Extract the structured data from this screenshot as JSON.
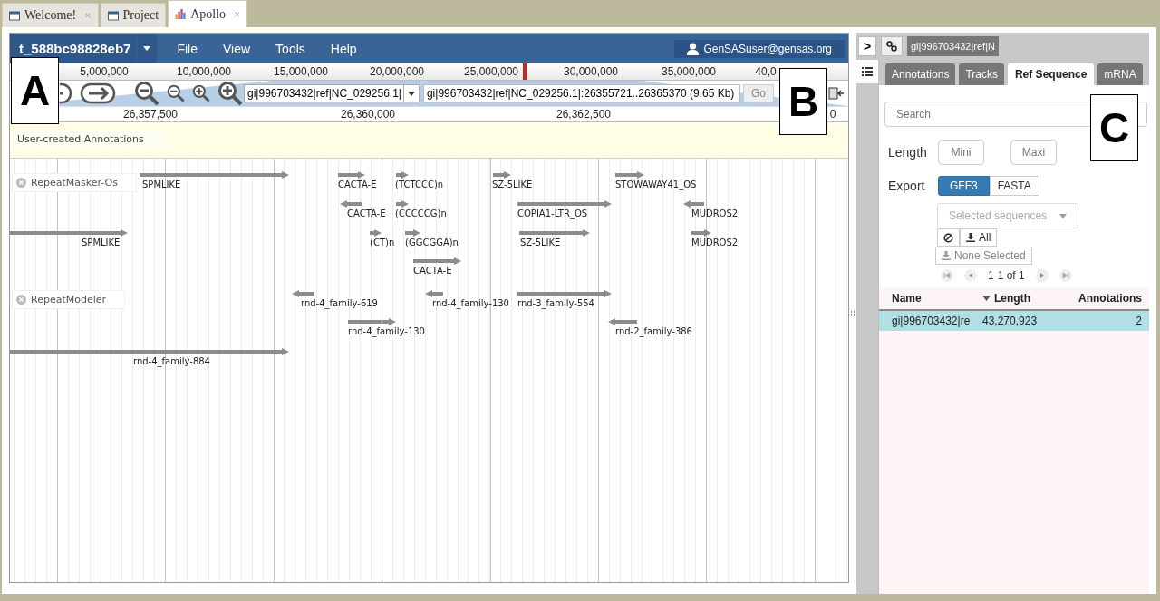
{
  "tabs": [
    {
      "label": "Welcome!",
      "close": "×",
      "selected": false
    },
    {
      "label": "Project",
      "selected": false
    },
    {
      "label": "Apollo",
      "close": "×",
      "selected": true
    }
  ],
  "browser": {
    "track_menu": "t_588bc98828eb7",
    "menu": [
      "File",
      "View",
      "Tools",
      "Help"
    ],
    "user": "GenSASuser@gensas.org",
    "overview_ticks": [
      "5,000,000",
      "10,000,000",
      "15,000,000",
      "20,000,000",
      "25,000,000",
      "30,000,000",
      "35,000,000",
      "40,0"
    ],
    "sequence_select": "gi|996703432|ref|NC_029256.1|",
    "location": "gi|996703432|ref|NC_029256.1|:26355721..26365370 (9.65 Kb)",
    "go": "Go",
    "detail_ticks": [
      "26,357,500",
      "26,360,000",
      "26,362,500",
      "0"
    ],
    "user_track": "User-created Annotations",
    "tracks": [
      {
        "name": "RepeatMasker-Os",
        "features": [
          {
            "label": "SPMLIKE",
            "reverse": false
          },
          {
            "label": "CACTA-E",
            "reverse": false
          },
          {
            "label": "(TCTCCC)n",
            "reverse": false
          },
          {
            "label": "SZ-5LIKE",
            "reverse": false
          },
          {
            "label": "STOWAWAY41_OS",
            "reverse": false
          },
          {
            "label": "CACTA-E",
            "reverse": true
          },
          {
            "label": "(CCCCCG)n",
            "reverse": false
          },
          {
            "label": "COPIA1-LTR_OS",
            "reverse": false
          },
          {
            "label": "MUDROS2",
            "reverse": true
          },
          {
            "label": "SPMLIKE",
            "reverse": false
          },
          {
            "label": "(CT)n",
            "reverse": false
          },
          {
            "label": "(GGCGGA)n",
            "reverse": false
          },
          {
            "label": "SZ-5LIKE",
            "reverse": false
          },
          {
            "label": "MUDROS2",
            "reverse": false
          },
          {
            "label": "CACTA-E",
            "reverse": false
          }
        ]
      },
      {
        "name": "RepeatModeler",
        "features": [
          {
            "label": "rnd-4_family-619",
            "reverse": true
          },
          {
            "label": "rnd-4_family-130",
            "reverse": true
          },
          {
            "label": "rnd-3_family-554",
            "reverse": false
          },
          {
            "label": "rnd-4_family-130",
            "reverse": false
          },
          {
            "label": "rnd-2_family-386",
            "reverse": true
          },
          {
            "label": "rnd-4_family-884",
            "reverse": false
          }
        ]
      }
    ]
  },
  "side": {
    "collapse": ">",
    "sequence_tab": "gi|996703432|ref|N",
    "tabs": [
      {
        "label": "Annotations",
        "selected": false
      },
      {
        "label": "Tracks",
        "selected": false
      },
      {
        "label": "Ref Sequence",
        "selected": true
      },
      {
        "label": "mRNA",
        "selected": false
      }
    ],
    "search": {
      "placeholder": "Search"
    },
    "length_label": "Length",
    "min": {
      "placeholder": "Mini"
    },
    "max": {
      "placeholder": "Maxi"
    },
    "export_label": "Export",
    "formats": [
      {
        "label": "GFF3",
        "selected": true
      },
      {
        "label": "FASTA",
        "selected": false
      }
    ],
    "scope": {
      "placeholder": "Selected sequences"
    },
    "all": "All",
    "none_selected": "None Selected",
    "pager": "1-1 of 1",
    "columns": [
      {
        "label": "Name",
        "sorted": false
      },
      {
        "label": "Length",
        "sorted": true
      },
      {
        "label": "Annotations",
        "sorted": false
      }
    ],
    "rows": [
      {
        "name": "gi|996703432|re",
        "length": "43,270,923",
        "annotations": "2",
        "selected": true
      }
    ]
  },
  "overlay_labels": [
    "A",
    "B",
    "C"
  ]
}
